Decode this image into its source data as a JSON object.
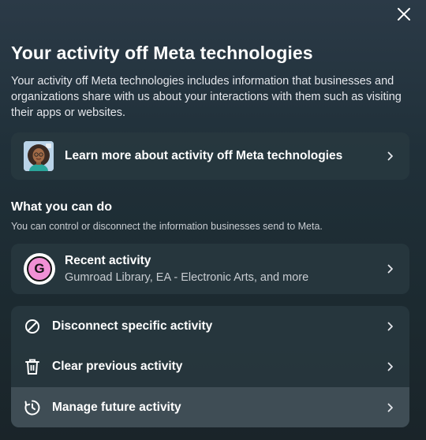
{
  "dialog": {
    "close_icon": "close-icon",
    "title": "Your activity off Meta technologies",
    "description": "Your activity off Meta technologies includes information that businesses and organizations share with us about your interactions with them such as visiting their apps or websites."
  },
  "learn_more": {
    "label": "Learn more about activity off Meta technologies"
  },
  "what_you_can_do": {
    "title": "What you can do",
    "subtitle": "You can control or disconnect the information businesses send to Meta."
  },
  "recent_activity": {
    "badge_letter": "G",
    "title": "Recent activity",
    "subtitle": "Gumroad Library, EA - Electronic Arts, and more"
  },
  "actions": [
    {
      "label": "Disconnect specific activity",
      "icon": "disconnect-icon"
    },
    {
      "label": "Clear previous activity",
      "icon": "trash-icon"
    },
    {
      "label": "Manage future activity",
      "icon": "history-icon"
    }
  ],
  "colors": {
    "background": "#203039",
    "card": "#283840",
    "highlight": "#48565e",
    "text": "#ffffff",
    "subtext": "#c8ccd1",
    "badge": "#f090d5"
  }
}
